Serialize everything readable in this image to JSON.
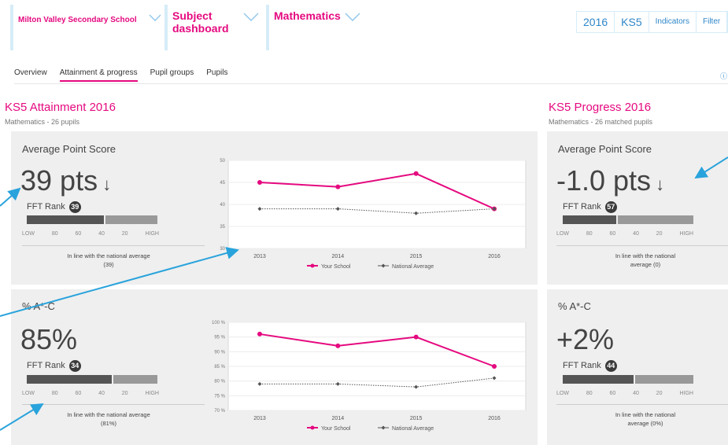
{
  "header": {
    "school": "Milton Valley Secondary School",
    "dashboard": "Subject dashboard",
    "subject": "Mathematics",
    "filters": [
      "2016",
      "KS5",
      "Indicators",
      "Filter"
    ]
  },
  "tabs": [
    "Overview",
    "Attainment & progress",
    "Pupil groups",
    "Pupils"
  ],
  "share_label": "ⓘ",
  "attainment": {
    "title": "KS5 Attainment 2016",
    "subtitle": "Mathematics - 26 pupils",
    "aps": {
      "label": "Average Point Score",
      "value": "39 pts",
      "rank_label": "FFT Rank",
      "rank": "39",
      "scale": [
        "LOW",
        "80",
        "60",
        "40",
        "20",
        "HIGH"
      ],
      "note": "In line with the national average (39)"
    },
    "ac": {
      "label": "% A*-C",
      "value": "85%",
      "rank_label": "FFT Rank",
      "rank": "34",
      "scale": [
        "LOW",
        "80",
        "60",
        "40",
        "20",
        "HIGH"
      ],
      "note": "In line with the national average (81%)"
    }
  },
  "progress": {
    "title": "KS5 Progress 2016",
    "subtitle": "Mathematics - 26 matched pupils",
    "aps": {
      "label": "Average Point Score",
      "value": "-1.0 pts",
      "rank_label": "FFT Rank",
      "rank": "57",
      "scale": [
        "LOW",
        "80",
        "60",
        "40",
        "20",
        "HIGH"
      ],
      "note": "In line with the national average (0)"
    },
    "ac": {
      "label": "% A*-C",
      "value": "+2%",
      "rank_label": "FFT Rank",
      "rank": "44",
      "scale": [
        "LOW",
        "80",
        "60",
        "40",
        "20",
        "HIGH"
      ],
      "note": "In line with the national average (0%)"
    }
  },
  "colors": {
    "accent": "#e5097f",
    "link": "#2f87c9",
    "arrow": "#29a3dc",
    "national": "#555555"
  },
  "chart_data": [
    {
      "type": "line",
      "categories": [
        "2013",
        "2014",
        "2015",
        "2016"
      ],
      "series": [
        {
          "name": "Your School",
          "values": [
            45,
            44,
            47,
            39
          ],
          "color": "#e5097f"
        },
        {
          "name": "National Average",
          "values": [
            39,
            39,
            38,
            39
          ],
          "color": "#555555"
        }
      ],
      "yticks": [
        "30",
        "35",
        "40",
        "45",
        "50"
      ],
      "ylim": [
        30,
        50
      ]
    },
    {
      "type": "line",
      "categories": [
        "2013",
        "2014",
        "2015",
        "2016"
      ],
      "series": [
        {
          "name": "Your School",
          "values": [
            96,
            92,
            95,
            85
          ],
          "color": "#e5097f"
        },
        {
          "name": "National Average",
          "values": [
            79,
            79,
            78,
            81
          ],
          "color": "#555555"
        }
      ],
      "yticks": [
        "70 %",
        "75 %",
        "80 %",
        "85 %",
        "90 %",
        "95 %",
        "100 %"
      ],
      "ylim": [
        70,
        100
      ]
    }
  ]
}
